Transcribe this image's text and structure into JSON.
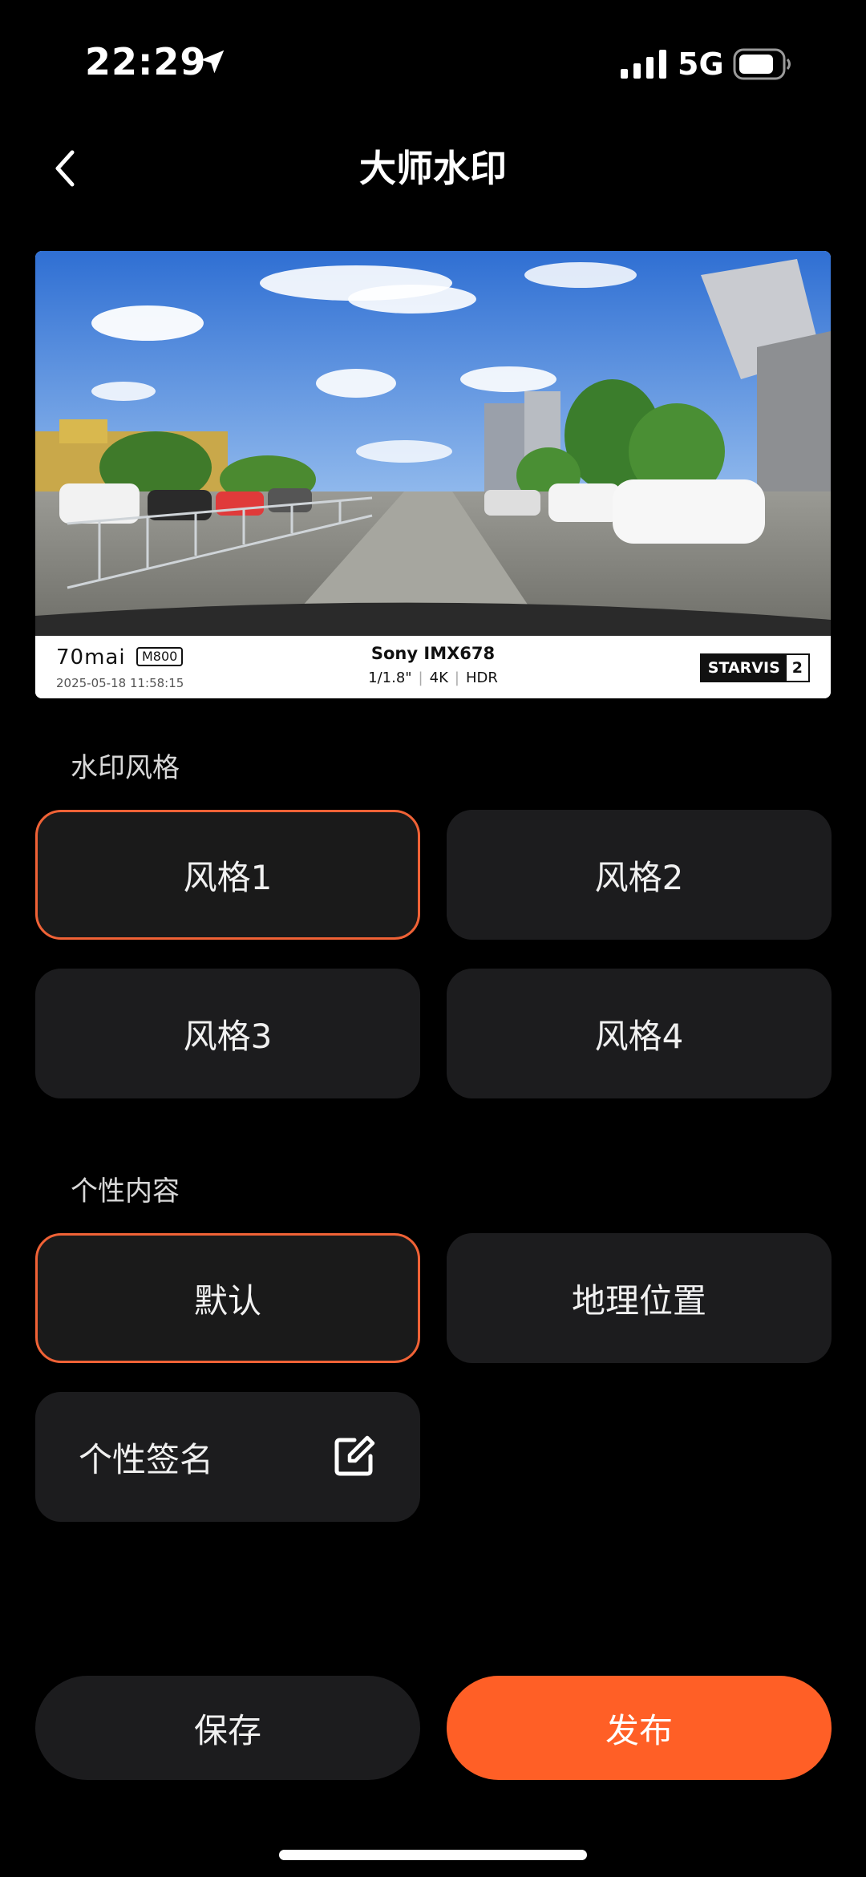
{
  "status_bar": {
    "time": "22:29",
    "network": "5G"
  },
  "nav": {
    "title": "大师水印"
  },
  "preview": {
    "watermark": {
      "brand": "70mai",
      "model": "M800",
      "datetime": "2025-05-18 11:58:15",
      "sensor": "Sony IMX678",
      "specs": [
        "1/1.8\"",
        "4K",
        "HDR"
      ],
      "badge_text": "STARVIS",
      "badge_number": "2"
    }
  },
  "watermark_style": {
    "label": "水印风格",
    "options": [
      "风格1",
      "风格2",
      "风格3",
      "风格4"
    ],
    "selected": "风格1"
  },
  "custom_content": {
    "label": "个性内容",
    "options": [
      "默认",
      "地理位置",
      "个性签名"
    ],
    "selected": "默认"
  },
  "actions": {
    "save": "保存",
    "publish": "发布"
  },
  "colors": {
    "accent": "#ff5f26",
    "selected_border": "#f06236",
    "card_bg": "#1c1c1e",
    "background": "#000000"
  },
  "icons": {
    "back": "chevron-left-icon",
    "location": "location-arrow-icon",
    "signal": "cellular-signal-icon",
    "battery": "battery-icon",
    "edit": "edit-icon"
  }
}
